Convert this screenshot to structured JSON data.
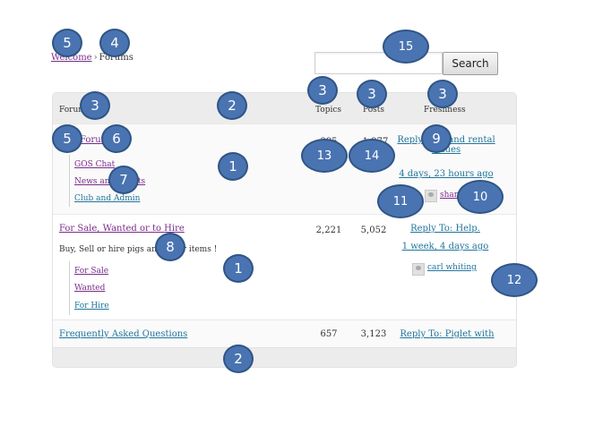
{
  "breadcrumb": {
    "home": "Welcome",
    "separator": "›",
    "current": "Forums"
  },
  "search": {
    "placeholder": "",
    "button": "Search"
  },
  "table": {
    "headers": {
      "forum": "Forum",
      "topics": "Topics",
      "posts": "Posts",
      "freshness": "Freshness"
    },
    "rows": [
      {
        "title": "Forum",
        "subforums": [
          "GOS Chat",
          "News and Events",
          "Club and Admin"
        ],
        "topics": "395",
        "posts": "1,977",
        "freshness_link": "Reply To: Land rental values",
        "freshness_time": "4 days, 23 hours ago",
        "author": "sharon"
      },
      {
        "title": "For Sale, Wanted or to Hire",
        "description": "Buy, Sell or hire pigs and other items !",
        "subforums": [
          "For Sale",
          "Wanted",
          "For Hire"
        ],
        "topics": "2,221",
        "posts": "5,052",
        "freshness_link": "Reply To: Help.",
        "freshness_time": "1 week, 4 days ago",
        "author": "carl whiting"
      },
      {
        "title": "Frequently Asked Questions",
        "topics": "657",
        "posts": "3,123",
        "freshness_link": "Reply To: Piglet with"
      }
    ]
  },
  "annotations": [
    "5",
    "4",
    "15",
    "3",
    "2",
    "3",
    "3",
    "3",
    "5",
    "6",
    "9",
    "13",
    "14",
    "7",
    "1",
    "11",
    "10",
    "8",
    "1",
    "12",
    "2"
  ]
}
